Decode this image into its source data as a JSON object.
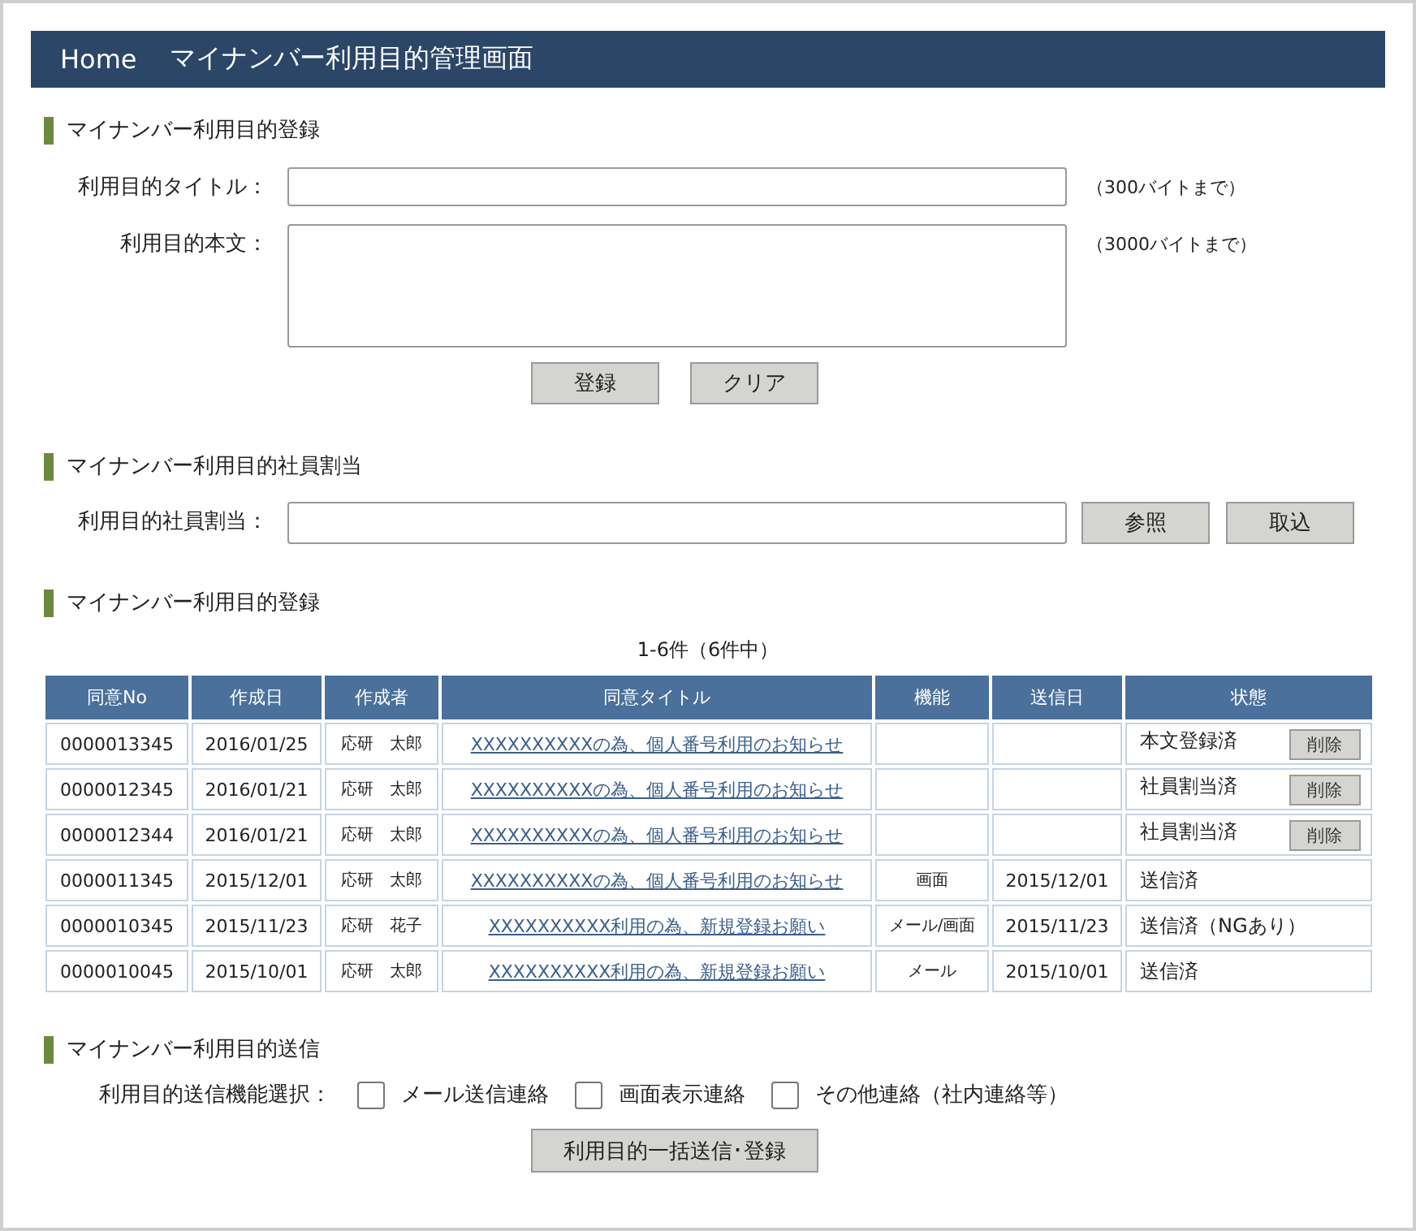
{
  "header": {
    "home": "Home",
    "title": "マイナンバー利用目的管理画面"
  },
  "register": {
    "heading": "マイナンバー利用目的登録",
    "fields": [
      {
        "label": "利用目的タイトル：",
        "kind": "line",
        "note": "（300バイトまで）"
      },
      {
        "label": "利用目的本文：",
        "kind": "area",
        "note": "（3000バイトまで）"
      }
    ],
    "buttons": [
      "登録",
      "クリア"
    ]
  },
  "assign": {
    "heading": "マイナンバー利用目的社員割当",
    "label": "利用目的社員割当：",
    "buttons": [
      "参照",
      "取込"
    ]
  },
  "list": {
    "heading": "マイナンバー利用目的登録",
    "count": "1-6件（6件中）",
    "columns": [
      "同意No",
      "作成日",
      "作成者",
      "同意タイトル",
      "機能",
      "送信日",
      "状態"
    ],
    "rows": [
      {
        "no": "0000013345",
        "created": "2016/01/25",
        "author": "応研　太郎",
        "title": "XXXXXXXXXXの為、個人番号利用のお知らせ",
        "function": "",
        "sent": "",
        "status": "本文登録済",
        "action": "削除"
      },
      {
        "no": "0000012345",
        "created": "2016/01/21",
        "author": "応研　太郎",
        "title": "XXXXXXXXXXの為、個人番号利用のお知らせ",
        "function": "",
        "sent": "",
        "status": "社員割当済",
        "action": "削除"
      },
      {
        "no": "0000012344",
        "created": "2016/01/21",
        "author": "応研　太郎",
        "title": "XXXXXXXXXXの為、個人番号利用のお知らせ",
        "function": "",
        "sent": "",
        "status": "社員割当済",
        "action": "削除"
      },
      {
        "no": "0000011345",
        "created": "2015/12/01",
        "author": "応研　太郎",
        "title": "XXXXXXXXXXの為、個人番号利用のお知らせ",
        "function": "画面",
        "sent": "2015/12/01",
        "status": "送信済"
      },
      {
        "no": "0000010345",
        "created": "2015/11/23",
        "author": "応研　花子",
        "title": "XXXXXXXXXX利用の為、新規登録お願い",
        "function": "メール/画面",
        "sent": "2015/11/23",
        "status": "送信済（NGあり）"
      },
      {
        "no": "0000010045",
        "created": "2015/10/01",
        "author": "応研　太郎",
        "title": "XXXXXXXXXX利用の為、新規登録お願い",
        "function": "メール",
        "sent": "2015/10/01",
        "status": "送信済"
      }
    ]
  },
  "send": {
    "heading": "マイナンバー利用目的送信",
    "label": "利用目的送信機能選択：",
    "options": [
      {
        "label": "メール送信連絡",
        "checked": false
      },
      {
        "label": "画面表示連絡",
        "checked": false
      },
      {
        "label": "その他連絡（社内連絡等）",
        "checked": false
      }
    ],
    "button": "利用目的一括送信･登録"
  }
}
